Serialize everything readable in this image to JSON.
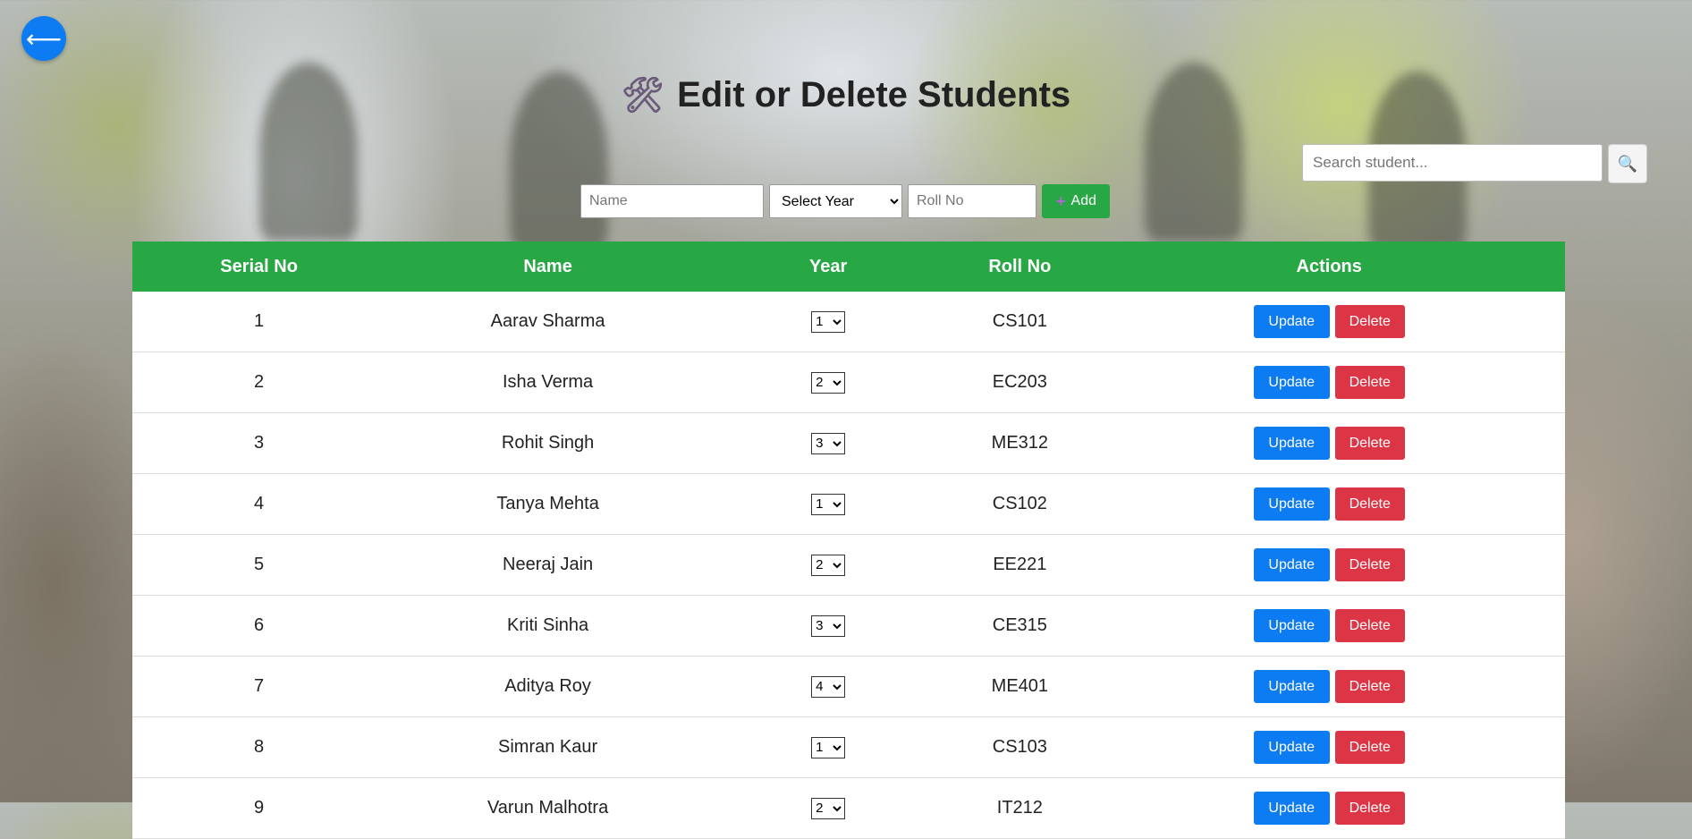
{
  "back_button": {
    "icon": "left-arrow-icon",
    "glyph": "⟵"
  },
  "page": {
    "title": "Edit or Delete Students",
    "title_icon": "🛠"
  },
  "search": {
    "placeholder": "Search student...",
    "icon": "🔍"
  },
  "add_form": {
    "name_placeholder": "Name",
    "year_selected": "Select Year",
    "roll_placeholder": "Roll No",
    "add_icon": "+",
    "add_label": "Add"
  },
  "table": {
    "headers": [
      "Serial No",
      "Name",
      "Year",
      "Roll No",
      "Actions"
    ],
    "rows": [
      {
        "serial": "1",
        "name": "Aarav Sharma",
        "year": "1",
        "roll": "CS101"
      },
      {
        "serial": "2",
        "name": "Isha Verma",
        "year": "2",
        "roll": "EC203"
      },
      {
        "serial": "3",
        "name": "Rohit Singh",
        "year": "3",
        "roll": "ME312"
      },
      {
        "serial": "4",
        "name": "Tanya Mehta",
        "year": "1",
        "roll": "CS102"
      },
      {
        "serial": "5",
        "name": "Neeraj Jain",
        "year": "2",
        "roll": "EE221"
      },
      {
        "serial": "6",
        "name": "Kriti Sinha",
        "year": "3",
        "roll": "CE315"
      },
      {
        "serial": "7",
        "name": "Aditya Roy",
        "year": "4",
        "roll": "ME401"
      },
      {
        "serial": "8",
        "name": "Simran Kaur",
        "year": "1",
        "roll": "CS103"
      },
      {
        "serial": "9",
        "name": "Varun Malhotra",
        "year": "2",
        "roll": "IT212"
      }
    ],
    "update_label": "Update",
    "delete_label": "Delete"
  },
  "colors": {
    "primary": "#0d7bf2",
    "success": "#28a745",
    "danger": "#dc3545"
  }
}
